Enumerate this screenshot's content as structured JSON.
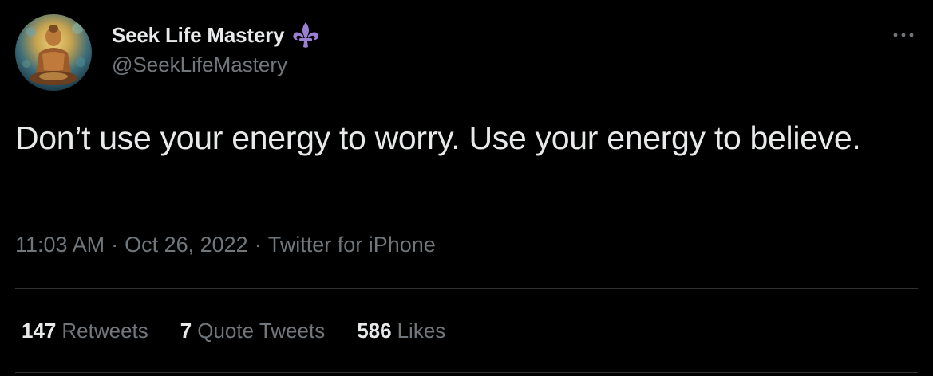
{
  "author": {
    "display_name": "Seek Life Mastery",
    "handle": "@SeekLifeMastery",
    "avatar_icon": "buddha-avatar",
    "badge_icon": "fleur-de-lis-icon",
    "badge_color": "#9b7fd0"
  },
  "tweet": {
    "text": "Don’t use your energy to worry. Use your energy to believe.",
    "time": "11:03 AM",
    "separator": "·",
    "date": "Oct 26, 2022",
    "source": "Twitter for iPhone"
  },
  "stats": {
    "retweets_count": "147",
    "retweets_label": "Retweets",
    "quotes_count": "7",
    "quotes_label": "Quote Tweets",
    "likes_count": "586",
    "likes_label": "Likes"
  },
  "colors": {
    "background": "#000000",
    "primary_text": "#e7e9ea",
    "secondary_text": "#71767b",
    "divider": "#2f3336"
  }
}
